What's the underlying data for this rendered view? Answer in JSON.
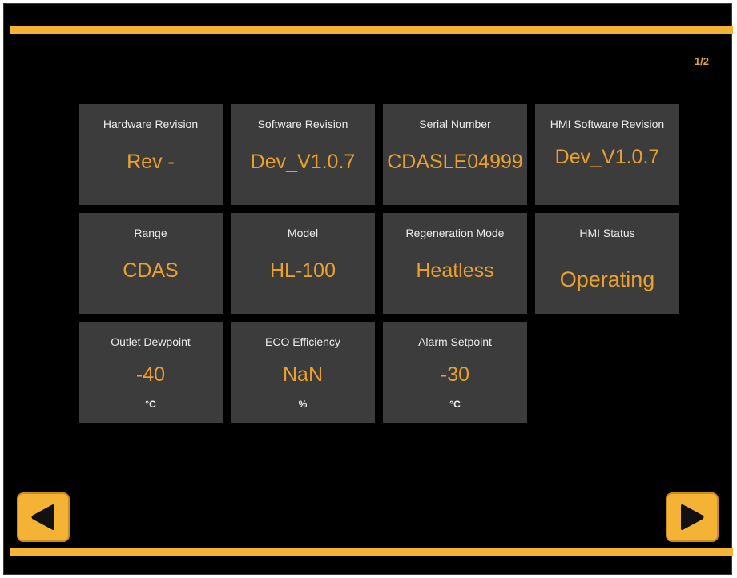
{
  "page_indicator": "1/2",
  "tiles": [
    {
      "label": "Hardware Revision",
      "value": "Rev -",
      "unit": ""
    },
    {
      "label": "Software Revision",
      "value": "Dev_V1.0.7",
      "unit": ""
    },
    {
      "label": "Serial Number",
      "value": "CDASLE04999",
      "unit": ""
    },
    {
      "label": "HMI Software Revision",
      "value": "Dev_V1.0.7",
      "unit": ""
    },
    {
      "label": "Range",
      "value": "CDAS",
      "unit": ""
    },
    {
      "label": "Model",
      "value": "HL-100",
      "unit": ""
    },
    {
      "label": "Regeneration Mode",
      "value": "Heatless",
      "unit": ""
    },
    {
      "label": "HMI Status",
      "value": "Operating",
      "unit": ""
    },
    {
      "label": "Outlet Dewpoint",
      "value": "-40",
      "unit": "°C"
    },
    {
      "label": "ECO Efficiency",
      "value": "NaN",
      "unit": "%"
    },
    {
      "label": "Alarm Setpoint",
      "value": "-30",
      "unit": "°C"
    }
  ],
  "nav": {
    "prev_icon": "left-arrow-icon",
    "next_icon": "right-arrow-icon"
  },
  "colors": {
    "accent": "#f5b335",
    "value_text": "#eaa02d",
    "tile_background": "#3c3c3c",
    "screen_background": "#000000"
  }
}
